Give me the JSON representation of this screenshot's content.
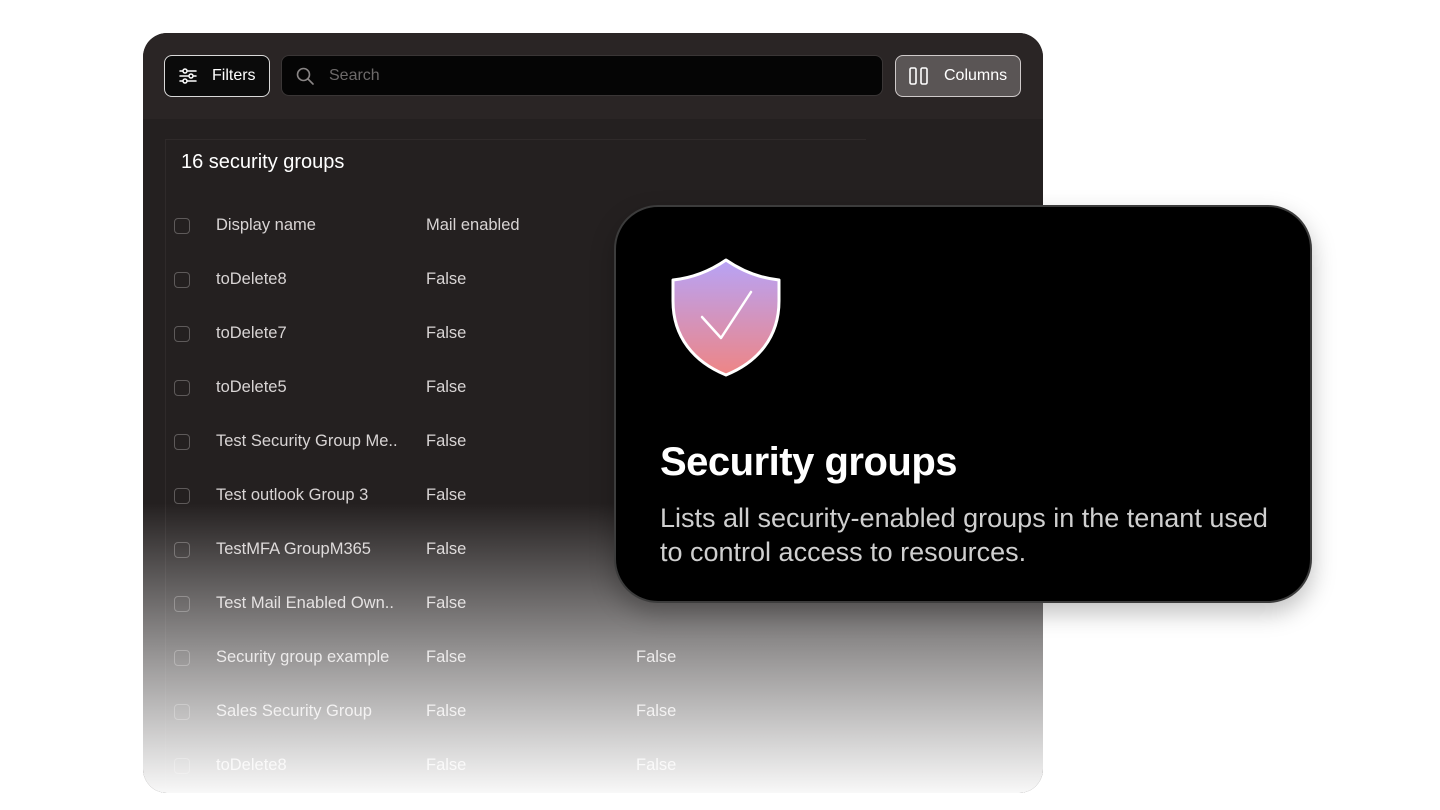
{
  "toolbar": {
    "filters_label": "Filters",
    "search_placeholder": "Search",
    "columns_label": "Columns"
  },
  "table": {
    "count_label": "16 security groups",
    "columns": [
      "Display name",
      "Mail enabled"
    ],
    "rows": [
      {
        "name": "toDelete8",
        "mail_enabled": "False",
        "col3": ""
      },
      {
        "name": "toDelete7",
        "mail_enabled": "False",
        "col3": ""
      },
      {
        "name": "toDelete5",
        "mail_enabled": "False",
        "col3": ""
      },
      {
        "name": "Test Security Group Me..",
        "mail_enabled": "False",
        "col3": ""
      },
      {
        "name": "Test outlook Group 3",
        "mail_enabled": "False",
        "col3": ""
      },
      {
        "name": "TestMFA GroupM365",
        "mail_enabled": "False",
        "col3": ""
      },
      {
        "name": "Test Mail Enabled Own..",
        "mail_enabled": "False",
        "col3": ""
      },
      {
        "name": "Security group example",
        "mail_enabled": "False",
        "col3": "False"
      },
      {
        "name": "Sales Security Group",
        "mail_enabled": "False",
        "col3": "False"
      },
      {
        "name": "toDelete8",
        "mail_enabled": "False",
        "col3": "False"
      }
    ]
  },
  "card": {
    "title": "Security groups",
    "description": "Lists all security-enabled groups in the tenant used to control access to resources.",
    "icon": "shield-check-icon"
  },
  "colors": {
    "panel_bg": "#242020",
    "card_bg": "#000000",
    "shield_gradient_top": "#b7a3f7",
    "shield_gradient_bottom": "#ee8585"
  }
}
